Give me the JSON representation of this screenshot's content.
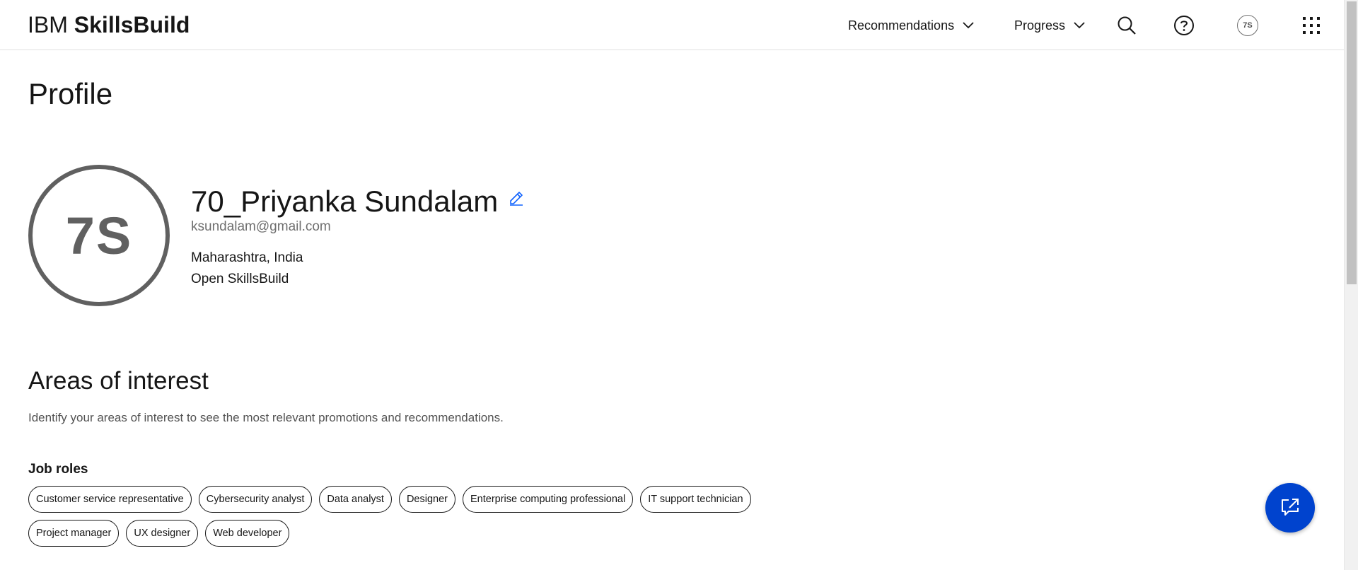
{
  "header": {
    "brand_prefix": "IBM",
    "brand_name": "SkillsBuild",
    "nav": {
      "recommendations": "Recommendations",
      "progress": "Progress"
    },
    "avatar_initials": "7S"
  },
  "page": {
    "title": "Profile"
  },
  "profile": {
    "initials": "7S",
    "name": "70_Priyanka Sundalam",
    "email": "ksundalam@gmail.com",
    "location": "Maharashtra, India",
    "organization": "Open SkillsBuild"
  },
  "interests": {
    "title": "Areas of interest",
    "description": "Identify your areas of interest to see the most relevant promotions and recommendations.",
    "job_roles_title": "Job roles",
    "job_roles_row1": [
      "Customer service representative",
      "Cybersecurity analyst",
      "Data analyst",
      "Designer",
      "Enterprise computing professional",
      "IT support technician"
    ],
    "job_roles_row2": [
      "Project manager",
      "UX designer",
      "Web developer"
    ]
  },
  "colors": {
    "accent": "#0043ce",
    "edit_icon": "#0f62fe",
    "avatar_gray": "#606060"
  },
  "icons": {
    "search": "search-icon",
    "help": "help-icon",
    "apps": "app-switcher-icon",
    "edit": "edit-icon",
    "chat": "chat-launch-icon",
    "chevron": "chevron-down-icon"
  }
}
